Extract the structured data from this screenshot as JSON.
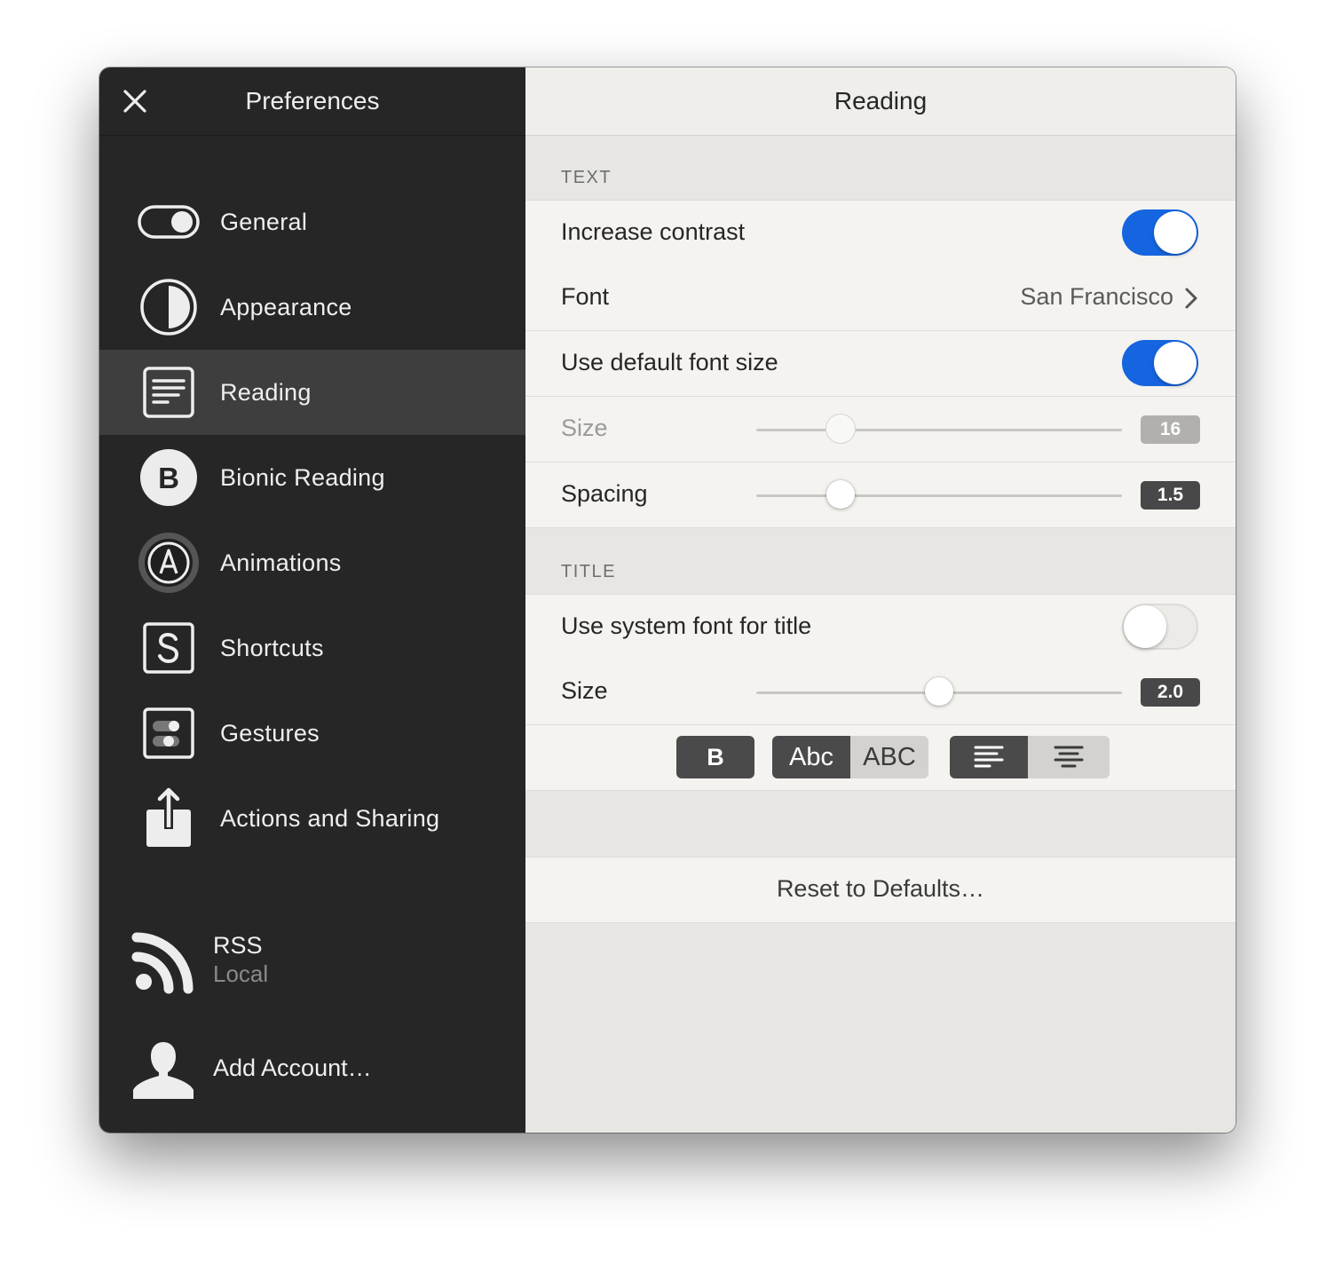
{
  "sidebar": {
    "title": "Preferences",
    "close_icon": "close-icon",
    "items": [
      {
        "label": "General",
        "icon": "toggle-icon"
      },
      {
        "label": "Appearance",
        "icon": "half-circle-icon"
      },
      {
        "label": "Reading",
        "icon": "text-lines-icon",
        "active": true
      },
      {
        "label": "Bionic Reading",
        "icon": "br-logo-icon"
      },
      {
        "label": "Animations",
        "icon": "animations-a-icon"
      },
      {
        "label": "Shortcuts",
        "icon": "shortcut-s-icon"
      },
      {
        "label": "Gestures",
        "icon": "gestures-icon"
      },
      {
        "label": "Actions and Sharing",
        "icon": "share-icon"
      }
    ],
    "accounts": [
      {
        "name": "RSS",
        "sub": "Local",
        "icon": "rss-icon"
      },
      {
        "name": "Add Account…",
        "icon": "user-silhouette-icon"
      }
    ]
  },
  "main": {
    "title": "Reading",
    "text_section": {
      "header": "TEXT",
      "increase_contrast": {
        "label": "Increase contrast",
        "on": true
      },
      "font": {
        "label": "Font",
        "value": "San Francisco"
      },
      "default_font_size": {
        "label": "Use default font size",
        "on": true
      },
      "size": {
        "label": "Size",
        "value": "16",
        "fraction": 0.23,
        "enabled": false
      },
      "spacing": {
        "label": "Spacing",
        "value": "1.5",
        "fraction": 0.23
      }
    },
    "title_section": {
      "header": "TITLE",
      "system_font": {
        "label": "Use system font for title",
        "on": false
      },
      "size": {
        "label": "Size",
        "value": "2.0",
        "fraction": 0.5
      },
      "style_buttons": {
        "bold": "B",
        "case_normal": "Abc",
        "case_upper": "ABC"
      }
    },
    "reset_label": "Reset to Defaults…"
  },
  "colors": {
    "sidebar_bg": "#262626",
    "sidebar_active": "#3e3e3e",
    "toggle_on": "#1565e0",
    "main_bg": "#e7e6e3",
    "row_bg": "#f4f3f0"
  }
}
